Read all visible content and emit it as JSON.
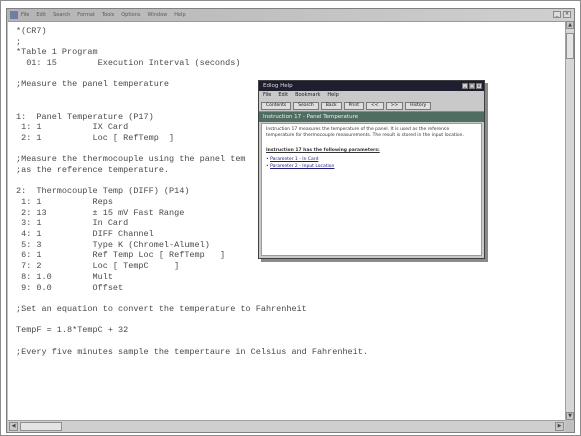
{
  "menu": [
    "File",
    "Edit",
    "Search",
    "Format",
    "Tools",
    "Options",
    "Window",
    "Help"
  ],
  "code_lines": [
    "*(CR7)",
    ";",
    "*Table 1 Program",
    "  01: 15        Execution Interval (seconds)",
    "",
    ";Measure the panel temperature",
    "",
    "",
    "1:  Panel Temperature (P17)",
    " 1: 1          IX Card",
    " 2: 1          Loc [ RefTemp  ]",
    "",
    ";Measure the thermocouple using the panel tem",
    ";as the reference temperature.",
    "",
    "2:  Thermocouple Temp (DIFF) (P14)",
    " 1: 1          Reps",
    " 2: 13         ± 15 mV Fast Range",
    " 3: 1          In Card",
    " 4: 1          DIFF Channel",
    " 5: 3          Type K (Chromel-Alumel)",
    " 6: 1          Ref Temp Loc [ RefTemp   ]",
    " 7: 2          Loc [ TempC     ]",
    " 8: 1.0        Mult",
    " 9: 0.0        Offset",
    "",
    ";Set an equation to convert the temperature to Fahrenheit",
    "",
    "TempF = 1.8*TempC + 32",
    "",
    ";Every five minutes sample the tempertaure in Celsius and Fahrenheit."
  ],
  "popup": {
    "title": "Edlog Help",
    "menu": [
      "File",
      "Edit",
      "Bookmark",
      "Help"
    ],
    "toolbar": [
      "Contents",
      "Search",
      "Back",
      "Print",
      "<<",
      ">>",
      "History"
    ],
    "banner": "Instruction 17 - Panel Temperature",
    "description": "Instruction 17 measures the temperature of the panel. It is used as the reference temperature for thermocouple measurements. The result is stored in the input location.",
    "heading": "Instruction 17 has the following parameters:",
    "params": [
      {
        "bullet": "•",
        "label": "Parameter 1 - In Card"
      },
      {
        "bullet": "•",
        "label": "Parameter 2 - Input Location"
      }
    ]
  }
}
